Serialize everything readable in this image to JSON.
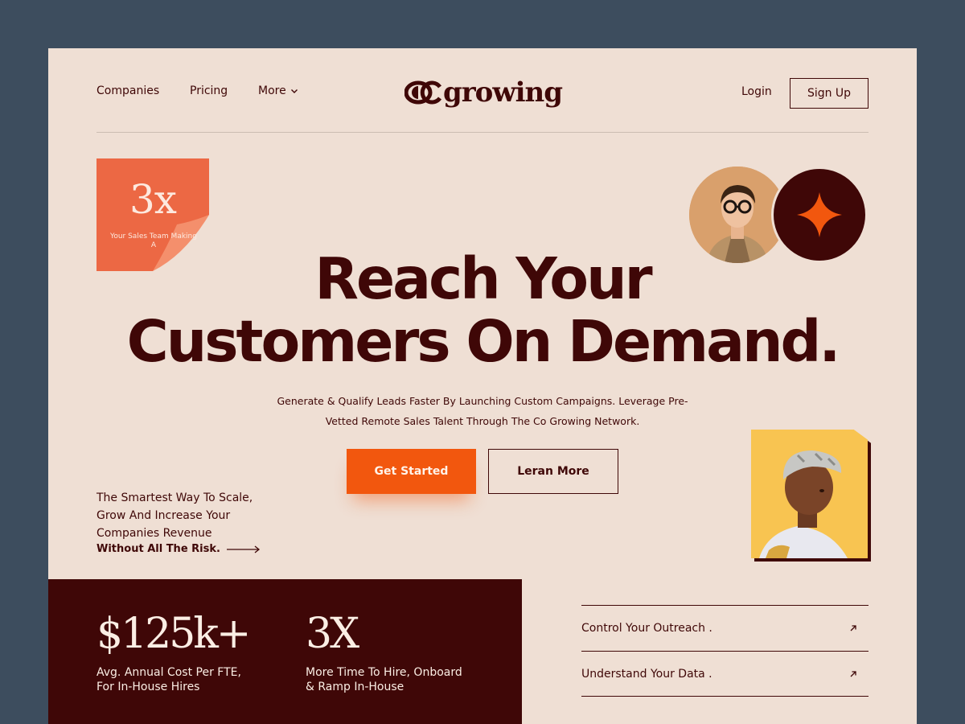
{
  "nav": {
    "companies": "Companies",
    "pricing": "Pricing",
    "more": "More",
    "logo": "growing",
    "login": "Login",
    "signup": "Sign Up"
  },
  "note": {
    "value": "3x",
    "text": "Your Sales Team Making A"
  },
  "hero": {
    "headline_line1": "Reach Your",
    "headline_line2": "Customers On Demand.",
    "subtext": "Generate & Qualify Leads Faster By Launching Custom Campaigns. Leverage Pre-Vetted Remote Sales Talent Through The Co Growing Network.",
    "cta_primary": "Get Started",
    "cta_secondary": "Leran More"
  },
  "tagline": {
    "text": "The Smartest Way To Scale, Grow And Increase Your Companies Revenue",
    "bold": "Without All The Risk."
  },
  "stats": [
    {
      "value": "$125k+",
      "desc": "Avg. Annual Cost Per FTE, For In-House Hires"
    },
    {
      "value": "3X",
      "desc": "More Time To Hire, Onboard & Ramp In-House"
    }
  ],
  "links": [
    {
      "label": "Control Your Outreach ."
    },
    {
      "label": "Understand Your Data ."
    }
  ],
  "colors": {
    "page_bg": "#3d4d5e",
    "card_bg": "#efdfd4",
    "brand_dark": "#3f0707",
    "accent_orange": "#f2570e",
    "note_orange": "#ec6844",
    "photo_yellow": "#f8c451"
  },
  "icons": {
    "more_chevron": "chevron-down-icon",
    "star": "sparkle-star-icon",
    "arrow": "arrow-right-icon",
    "link_arrow": "arrow-up-right-icon"
  }
}
